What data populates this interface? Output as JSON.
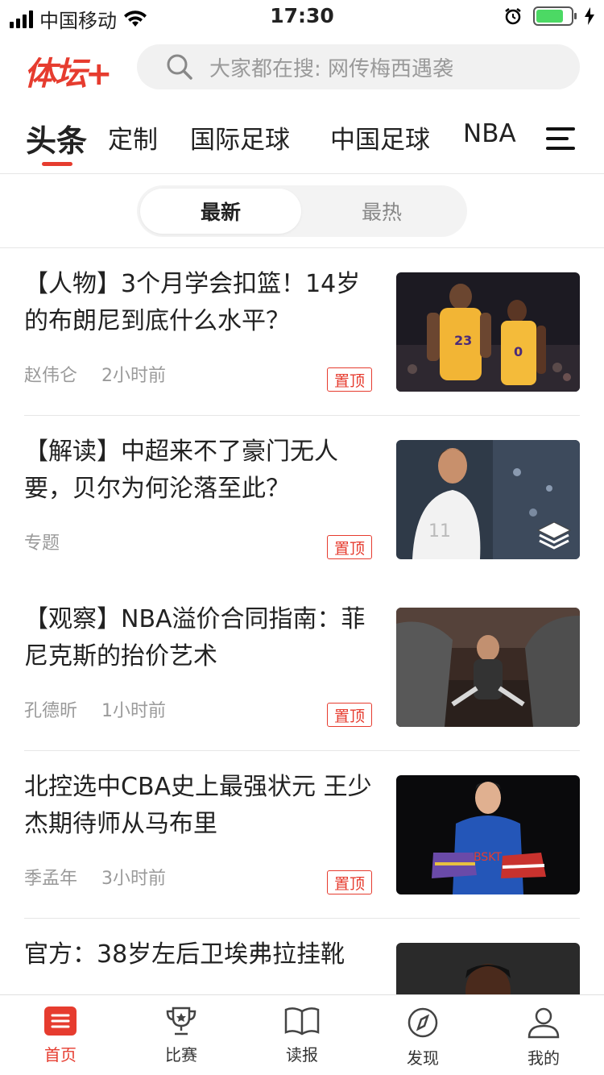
{
  "status_bar": {
    "carrier": "中国移动",
    "time": "17:30"
  },
  "header": {
    "logo": "体坛+",
    "search_placeholder": "大家都在搜: 网传梅西遇袭"
  },
  "tabs": [
    {
      "label": "头条",
      "active": true
    },
    {
      "label": "定制"
    },
    {
      "label": "国际足球"
    },
    {
      "label": "中国足球"
    },
    {
      "label": "NBA"
    }
  ],
  "segment": {
    "newest": "最新",
    "hottest": "最热"
  },
  "feed": [
    {
      "title": "【人物】3个月学会扣篮！14岁的布朗尼到底什么水平？",
      "author": "赵伟仑",
      "time": "2小时前",
      "pin": "置顶"
    },
    {
      "title": "【解读】中超来不了豪门无人要，贝尔为何沦落至此？",
      "author": "专题",
      "time": "",
      "pin": "置顶"
    },
    {
      "title": "【观察】NBA溢价合同指南：菲尼克斯的抬价艺术",
      "author": "孔德昕",
      "time": "1小时前",
      "pin": "置顶"
    },
    {
      "title": "北控选中CBA史上最强状元 王少杰期待师从马布里",
      "author": "季孟年",
      "time": "3小时前",
      "pin": "置顶"
    },
    {
      "title": "官方：38岁左后卫埃弗拉挂靴",
      "author": "",
      "time": "",
      "pin": ""
    }
  ],
  "bottom_nav": [
    {
      "label": "首页",
      "icon": "home-icon",
      "active": true
    },
    {
      "label": "比赛",
      "icon": "trophy-icon"
    },
    {
      "label": "读报",
      "icon": "book-icon"
    },
    {
      "label": "发现",
      "icon": "compass-icon"
    },
    {
      "label": "我的",
      "icon": "profile-icon"
    }
  ],
  "colors": {
    "accent": "#e63c2f"
  }
}
